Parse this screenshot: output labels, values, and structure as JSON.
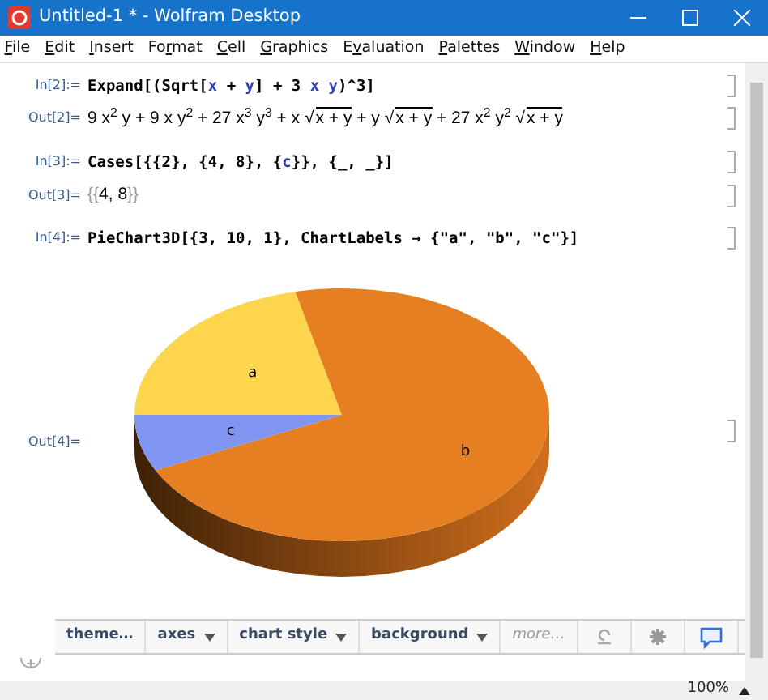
{
  "window": {
    "title": "Untitled-1 * - Wolfram Desktop"
  },
  "menu": [
    {
      "key": "F",
      "after": "ile"
    },
    {
      "key": "E",
      "after": "dit"
    },
    {
      "key": "I",
      "after": "nsert"
    },
    {
      "before": "Fo",
      "key": "r",
      "after": "mat"
    },
    {
      "key": "C",
      "after": "ell"
    },
    {
      "key": "G",
      "after": "raphics"
    },
    {
      "before": "E",
      "key": "v",
      "after": "aluation"
    },
    {
      "key": "P",
      "after": "alettes"
    },
    {
      "key": "W",
      "after": "indow"
    },
    {
      "key": "H",
      "after": "elp"
    }
  ],
  "cells": [
    {
      "kind": "input",
      "label": "In[2]:=",
      "tokens": [
        {
          "text": "Expand[(Sqrt[",
          "kind": "code"
        },
        {
          "text": "x",
          "kind": "var"
        },
        {
          "text": " + ",
          "kind": "code"
        },
        {
          "text": "y",
          "kind": "var"
        },
        {
          "text": "] + 3 ",
          "kind": "code"
        },
        {
          "text": "x y",
          "kind": "var"
        },
        {
          "text": ")^3]",
          "kind": "code"
        }
      ]
    },
    {
      "kind": "output",
      "label": "Out[2]=",
      "tokens": [
        {
          "text": "9 x$^{2}$ y + 9 x y$^{2}$ + 27 x$^{3}$ y$^{3}$ + x ",
          "kind": "math"
        },
        {
          "sign": "√",
          "text": "x + y",
          "kind": "sqrt"
        },
        {
          "text": " + y ",
          "kind": "math"
        },
        {
          "sign": "√",
          "text": "x + y",
          "kind": "sqrt"
        },
        {
          "text": " + 27 x$^{2}$ y$^{2}$ ",
          "kind": "math"
        },
        {
          "sign": "√",
          "text": "x + y",
          "kind": "sqrt"
        }
      ]
    },
    {
      "kind": "input",
      "label": "In[3]:=",
      "tokens": [
        {
          "text": "Cases[{{2}, {4, 8}, {",
          "kind": "code"
        },
        {
          "text": "c",
          "kind": "var"
        },
        {
          "text": "}}, {_, _}]",
          "kind": "code"
        }
      ]
    },
    {
      "kind": "output",
      "label": "Out[3]=",
      "tokens": [
        {
          "text": "{{",
          "kind": "brace"
        },
        {
          "text": "4, 8",
          "kind": "math"
        },
        {
          "text": "}}",
          "kind": "brace"
        }
      ]
    },
    {
      "kind": "input",
      "label": "In[4]:=",
      "tokens": [
        {
          "text": "PieChart3D[{3, 10, 1}, ChartLabels → {\"a\", \"b\", \"c\"}]",
          "kind": "code"
        }
      ]
    },
    {
      "kind": "graphics",
      "label": "Out[4]=",
      "slices": [
        {
          "label": "a",
          "color": "#fdd64e"
        },
        {
          "label": "b",
          "color": "#e67e22"
        },
        {
          "label": "c",
          "color": "#8095f0"
        }
      ]
    }
  ],
  "toolbar": [
    {
      "label": "theme…",
      "kind": "plain"
    },
    {
      "label": "axes",
      "kind": "dropdown"
    },
    {
      "label": "chart style",
      "kind": "dropdown"
    },
    {
      "label": "background",
      "kind": "dropdown"
    },
    {
      "label": "more…",
      "kind": "more"
    }
  ],
  "status_bar": {
    "zoom": "100%"
  }
}
